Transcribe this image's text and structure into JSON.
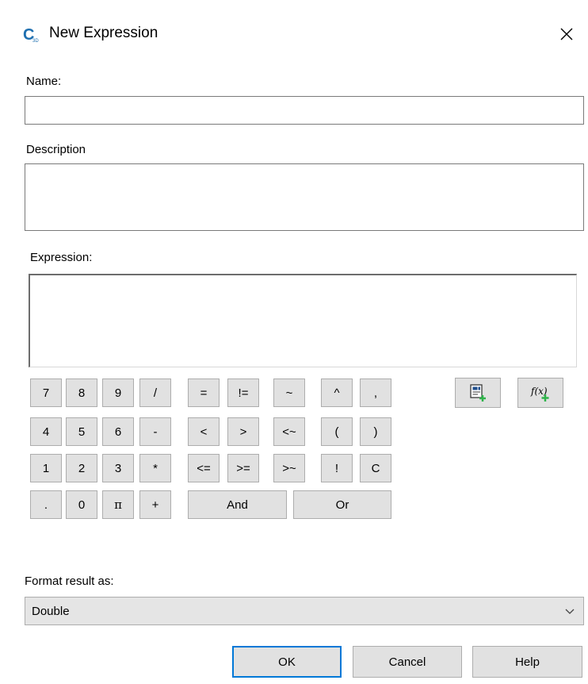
{
  "window": {
    "title": "New Expression",
    "close_glyph": "✕"
  },
  "app_icon": {
    "letter": "C",
    "color": "#1e6fb0",
    "sub": "3D"
  },
  "fields": {
    "name_label": "Name:",
    "name_value": "",
    "description_label": "Description",
    "description_value": "",
    "expression_label": "Expression:",
    "expression_value": ""
  },
  "keypad": {
    "row1": [
      "7",
      "8",
      "9",
      "/",
      "=",
      "!=",
      "~",
      "^",
      ","
    ],
    "row2": [
      "4",
      "5",
      "6",
      "-",
      "<",
      ">",
      "<~",
      "(",
      ")"
    ],
    "row3": [
      "1",
      "2",
      "3",
      "*",
      "<=",
      ">=",
      ">~",
      "!",
      "C"
    ],
    "row4": [
      ".",
      "0",
      "π",
      "+",
      "And",
      "Or"
    ]
  },
  "tools": {
    "insert_property_icon": "insert-property-icon",
    "insert_function_icon": "insert-function-icon",
    "function_glyph": "f(x)"
  },
  "format": {
    "label": "Format result as:",
    "selected": "Double"
  },
  "buttons": {
    "ok": "OK",
    "cancel": "Cancel",
    "help": "Help"
  },
  "colors": {
    "accent": "#0078d7",
    "button_face": "#e1e1e1",
    "green_plus": "#2fb34a"
  }
}
